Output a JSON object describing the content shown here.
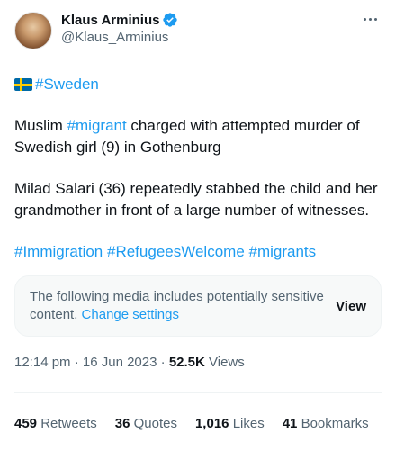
{
  "author": {
    "display_name": "Klaus Arminius",
    "handle": "@Klaus_Arminius"
  },
  "colors": {
    "accent": "#1d9bf0",
    "text": "#0f1419",
    "muted": "#536471"
  },
  "tweet": {
    "flag_icon": "sweden-flag-icon",
    "hashtag_sweden": "#Sweden",
    "para1_prefix": "Muslim ",
    "para1_hashtag": "#migrant",
    "para1_suffix": " charged with attempted murder of Swedish girl (9) in Gothenburg",
    "para2": "Milad Salari (36) repeatedly stabbed the child and her grandmother in front of a large number of witnesses.",
    "hashtags": [
      "#Immigration",
      "#RefugeesWelcome",
      "#migrants"
    ]
  },
  "sensitive_media": {
    "text": "The following media includes potentially sensitive content.",
    "link": "Change settings",
    "button": "View"
  },
  "meta": {
    "time": "12:14 pm",
    "date": "16 Jun 2023",
    "views_count": "52.5K",
    "views_label": "Views"
  },
  "stats": [
    {
      "count": "459",
      "label": "Retweets"
    },
    {
      "count": "36",
      "label": "Quotes"
    },
    {
      "count": "1,016",
      "label": "Likes"
    },
    {
      "count": "41",
      "label": "Bookmarks"
    }
  ]
}
